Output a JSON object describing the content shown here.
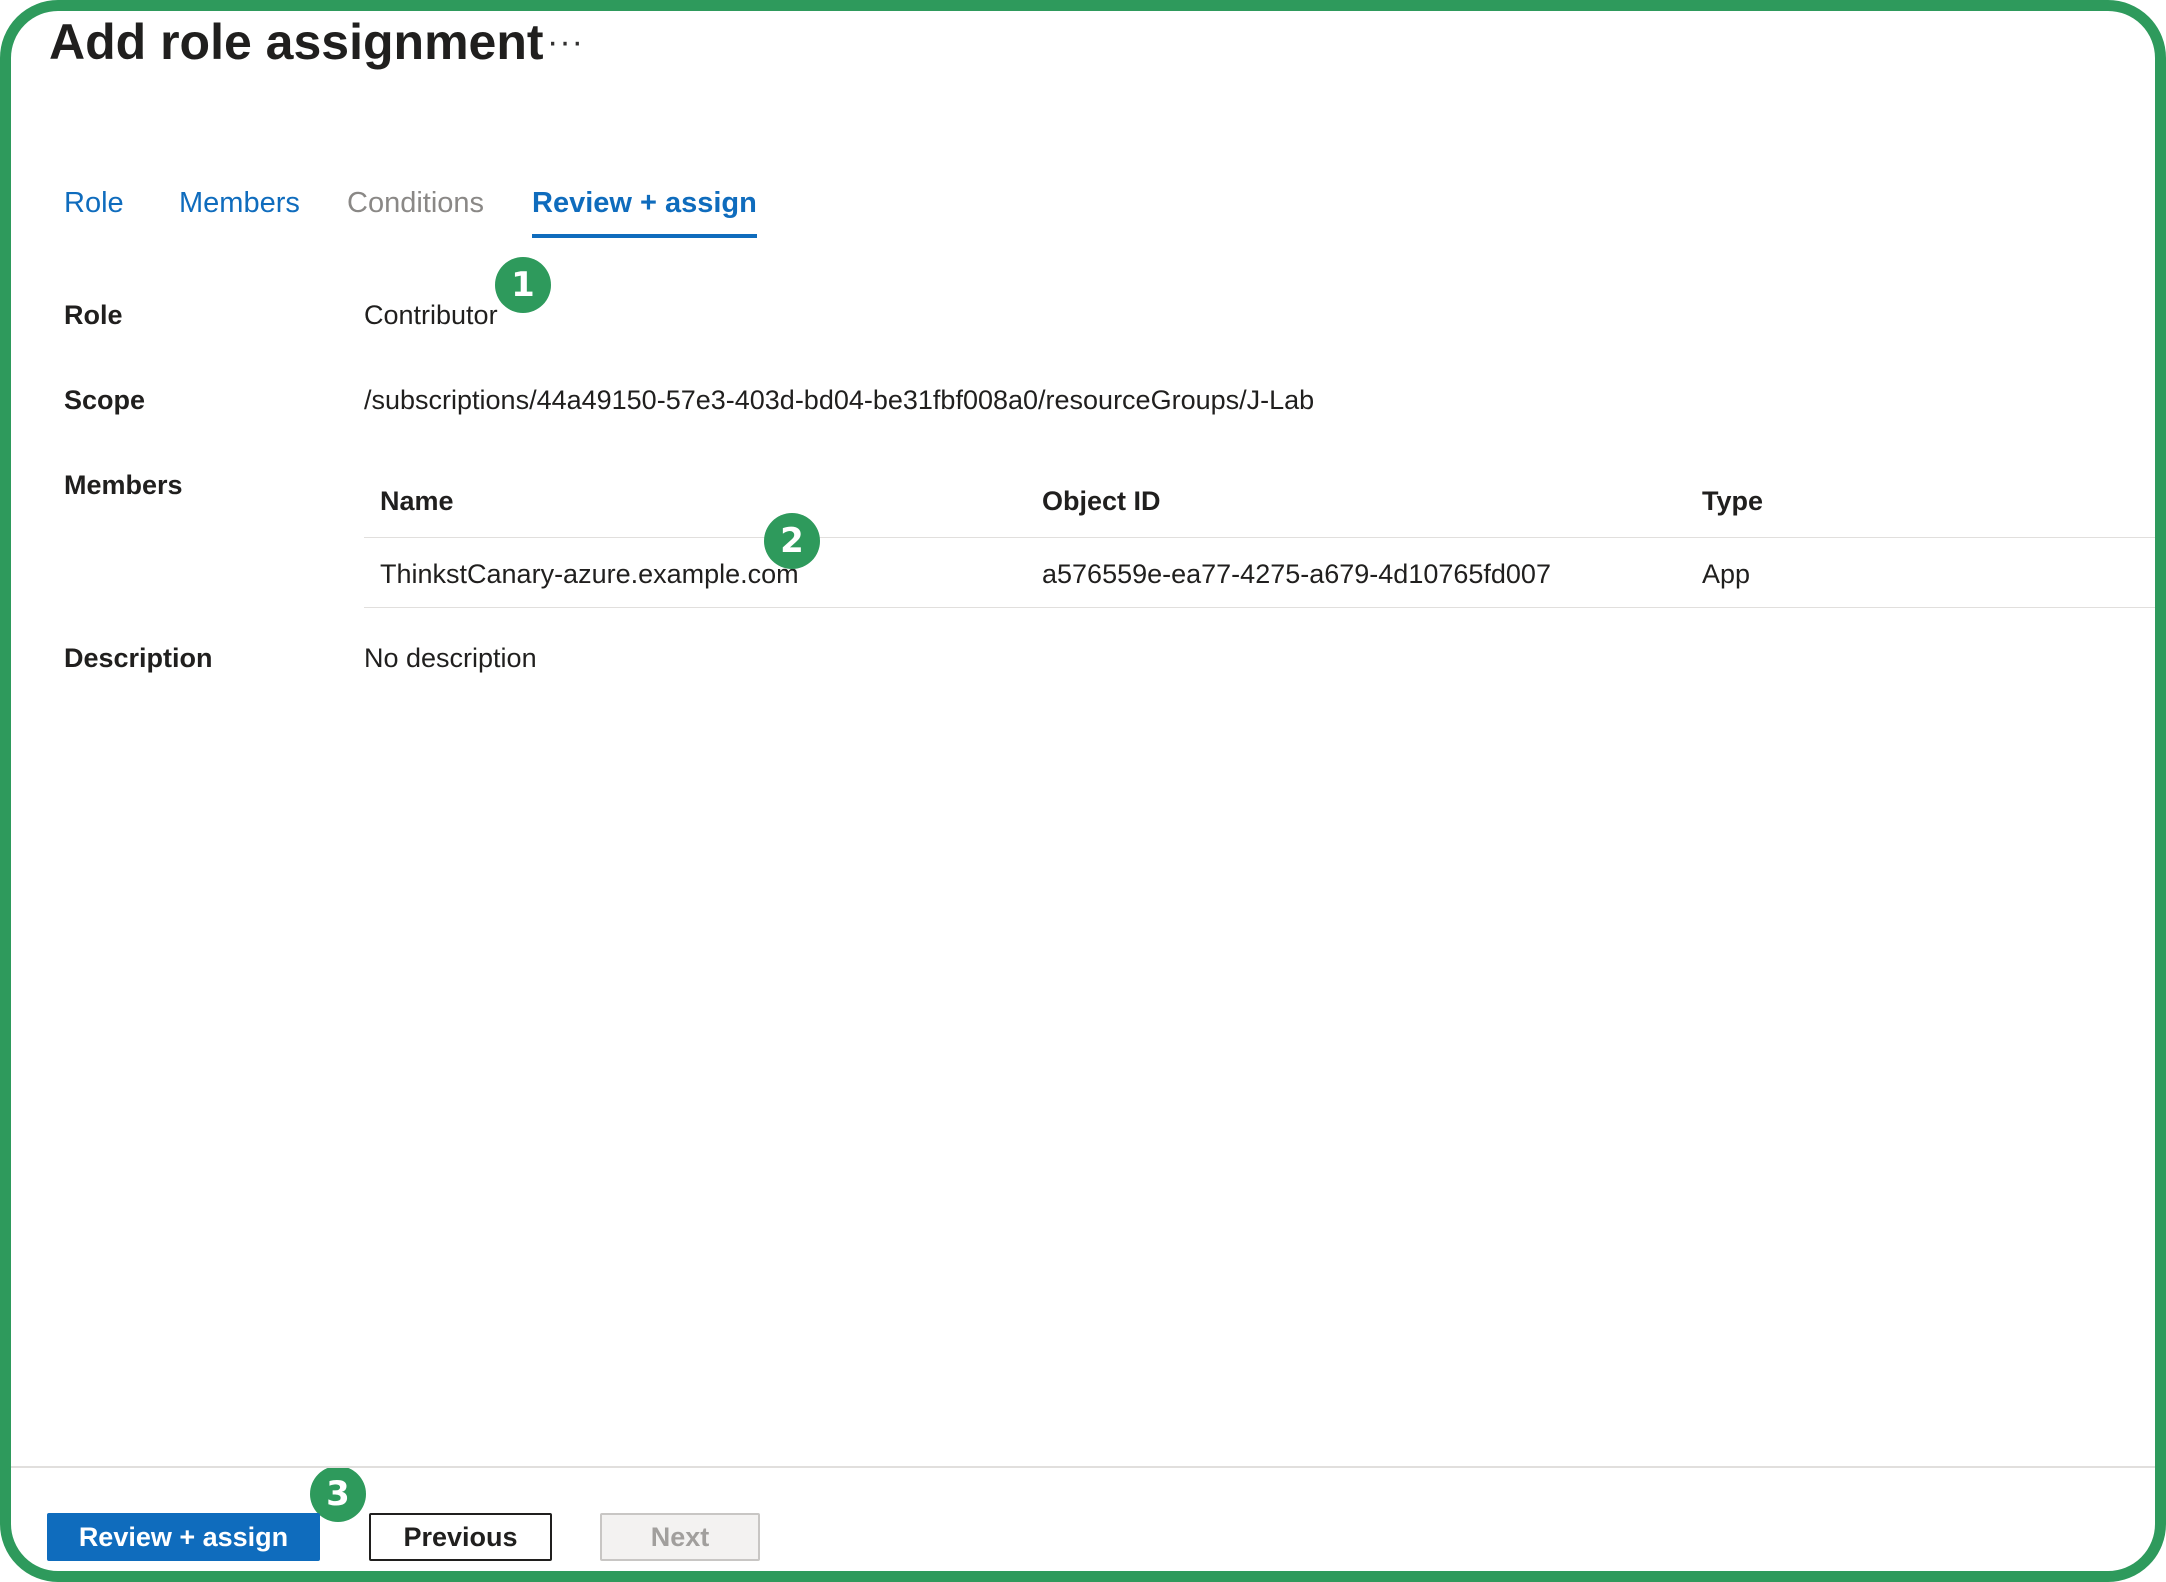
{
  "header": {
    "title": "Add role assignment",
    "more_label": "···"
  },
  "tabs": [
    {
      "label": "Role",
      "state": "enabled"
    },
    {
      "label": "Members",
      "state": "enabled"
    },
    {
      "label": "Conditions",
      "state": "disabled"
    },
    {
      "label": "Review + assign",
      "state": "active"
    }
  ],
  "review": {
    "role_label": "Role",
    "role_value": "Contributor",
    "scope_label": "Scope",
    "scope_value": "/subscriptions/44a49150-57e3-403d-bd04-be31fbf008a0/resourceGroups/J-Lab",
    "members_label": "Members",
    "description_label": "Description",
    "description_value": "No description"
  },
  "members_table": {
    "columns": [
      "Name",
      "Object ID",
      "Type"
    ],
    "rows": [
      [
        "ThinkstCanary-azure.example.com",
        "a576559e-ea77-4275-a679-4d10765fd007",
        "App"
      ]
    ]
  },
  "callouts": [
    "1",
    "2",
    "3"
  ],
  "footer": {
    "primary_label": "Review + assign",
    "previous_label": "Previous",
    "next_label": "Next"
  },
  "colors": {
    "frame": "#2e9a5c",
    "accent": "#0f6cbd",
    "disabled_text": "#a19f9d"
  }
}
